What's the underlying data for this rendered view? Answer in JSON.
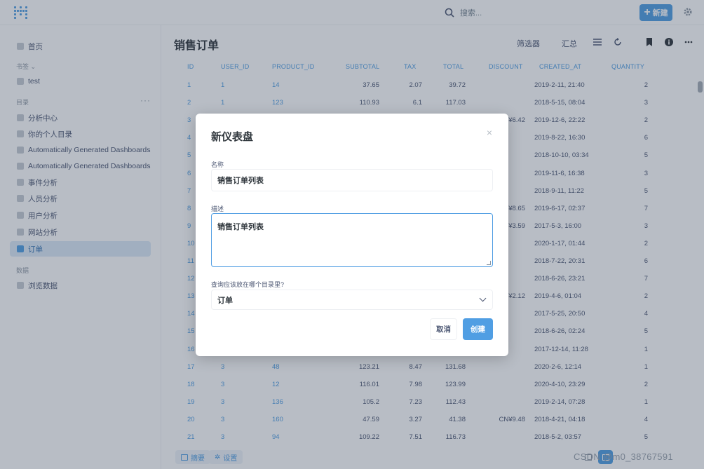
{
  "topbar": {
    "search_placeholder": "搜索...",
    "new_label": "新建"
  },
  "sidebar": {
    "home": "首页",
    "bookmarks_header": "书签",
    "bookmark_items": [
      "test"
    ],
    "collections_header": "目录",
    "collection_more": "···",
    "collection_items": [
      "分析中心",
      "你的个人目录",
      "Automatically Generated Dashboards",
      "Automatically Generated Dashboards",
      "事件分析",
      "人员分析",
      "用户分析",
      "网站分析",
      "订单"
    ],
    "data_header": "数据",
    "browse_data": "浏览数据"
  },
  "main": {
    "title": "销售订单",
    "filter_label": "筛选器",
    "summarize_label": "汇总",
    "footer_filter": "摘要",
    "footer_settings": "设置"
  },
  "table": {
    "columns": [
      "ID",
      "USER_ID",
      "PRODUCT_ID",
      "SUBTOTAL",
      "TAX",
      "TOTAL",
      "DISCOUNT",
      "CREATED_AT",
      "QUANTITY"
    ],
    "rows": [
      [
        "1",
        "1",
        "14",
        "37.65",
        "2.07",
        "39.72",
        "",
        "2019-2-11, 21:40",
        "2"
      ],
      [
        "2",
        "1",
        "123",
        "110.93",
        "6.1",
        "117.03",
        "",
        "2018-5-15, 08:04",
        "3"
      ],
      [
        "3",
        "",
        "",
        "",
        "",
        "",
        "¥6.42",
        "2019-12-6, 22:22",
        "2"
      ],
      [
        "4",
        "",
        "",
        "",
        "",
        "",
        "",
        "2019-8-22, 16:30",
        "6"
      ],
      [
        "5",
        "",
        "",
        "",
        "",
        "",
        "",
        "2018-10-10, 03:34",
        "5"
      ],
      [
        "6",
        "",
        "",
        "",
        "",
        "",
        "",
        "2019-11-6, 16:38",
        "3"
      ],
      [
        "7",
        "",
        "",
        "",
        "",
        "",
        "",
        "2018-9-11, 11:22",
        "5"
      ],
      [
        "8",
        "",
        "",
        "",
        "",
        "",
        "¥8.65",
        "2019-6-17, 02:37",
        "7"
      ],
      [
        "9",
        "",
        "",
        "",
        "",
        "",
        "¥3.59",
        "2017-5-3, 16:00",
        "3"
      ],
      [
        "10",
        "",
        "",
        "",
        "",
        "",
        "",
        "2020-1-17, 01:44",
        "2"
      ],
      [
        "11",
        "",
        "",
        "",
        "",
        "",
        "",
        "2018-7-22, 20:31",
        "6"
      ],
      [
        "12",
        "",
        "",
        "",
        "",
        "",
        "",
        "2018-6-26, 23:21",
        "7"
      ],
      [
        "13",
        "",
        "",
        "",
        "",
        "",
        "¥2.12",
        "2019-4-6, 01:04",
        "2"
      ],
      [
        "14",
        "",
        "",
        "",
        "",
        "",
        "",
        "2017-5-25, 20:50",
        "4"
      ],
      [
        "15",
        "",
        "",
        "",
        "",
        "",
        "",
        "2018-6-26, 02:24",
        "5"
      ],
      [
        "16",
        "",
        "",
        "",
        "",
        "",
        "",
        "2017-12-14, 11:28",
        "1"
      ],
      [
        "17",
        "3",
        "48",
        "123.21",
        "8.47",
        "131.68",
        "",
        "2020-2-6, 12:14",
        "1"
      ],
      [
        "18",
        "3",
        "12",
        "116.01",
        "7.98",
        "123.99",
        "",
        "2020-4-10, 23:29",
        "2"
      ],
      [
        "19",
        "3",
        "136",
        "105.2",
        "7.23",
        "112.43",
        "",
        "2019-2-14, 07:28",
        "1"
      ],
      [
        "20",
        "3",
        "160",
        "47.59",
        "3.27",
        "41.38",
        "CN¥9.48",
        "2018-4-21, 04:18",
        "4"
      ],
      [
        "21",
        "3",
        "94",
        "109.22",
        "7.51",
        "116.73",
        "",
        "2018-5-2, 03:57",
        "5"
      ]
    ]
  },
  "modal": {
    "title": "新仪表盘",
    "close": "×",
    "name_label": "名称",
    "name_value": "销售订单列表",
    "desc_label": "描述",
    "desc_value": "销售订单列表",
    "collection_label": "查询应该放在哪个目录里?",
    "collection_value": "订单",
    "cancel_label": "取消",
    "create_label": "创建"
  },
  "watermark": "CSDN @m0_38767591",
  "colors": {
    "accent": "#509ee3",
    "text": "#4c5773",
    "overlay": "rgba(48,62,84,0.34)"
  }
}
